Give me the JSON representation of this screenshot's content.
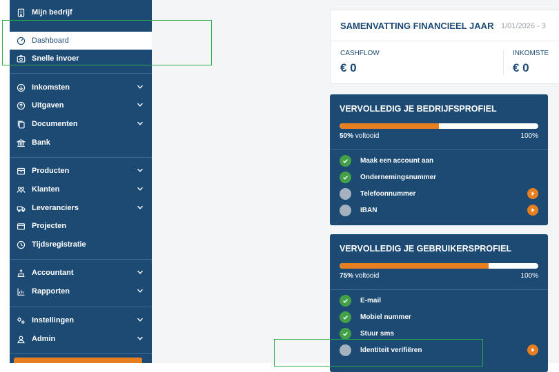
{
  "sidebar": {
    "items": [
      {
        "label": "Mijn bedrijf",
        "icon": "building-icon"
      },
      {
        "label": "Dashboard",
        "icon": "dashboard-gauge-icon"
      },
      {
        "label": "Snelle invoer",
        "icon": "camera-icon"
      },
      {
        "label": "Inkomsten",
        "icon": "arrow-down-circle-icon"
      },
      {
        "label": "Uitgaven",
        "icon": "arrow-up-circle-icon"
      },
      {
        "label": "Documenten",
        "icon": "documents-icon"
      },
      {
        "label": "Bank",
        "icon": "bank-icon"
      },
      {
        "label": "Producten",
        "icon": "box-icon"
      },
      {
        "label": "Klanten",
        "icon": "customers-icon"
      },
      {
        "label": "Leveranciers",
        "icon": "truck-icon"
      },
      {
        "label": "Projecten",
        "icon": "folder-icon"
      },
      {
        "label": "Tijdsregistratie",
        "icon": "clock-icon"
      },
      {
        "label": "Accountant",
        "icon": "accountant-icon"
      },
      {
        "label": "Rapporten",
        "icon": "reports-icon"
      },
      {
        "label": "Instellingen",
        "icon": "settings-icon"
      },
      {
        "label": "Admin",
        "icon": "admin-user-icon"
      }
    ]
  },
  "summary": {
    "title": "SAMENVATTING FINANCIEEL JAAR",
    "date": "1/01/2026 - 3",
    "kpis": [
      {
        "label": "CASHFLOW",
        "value": "€ 0"
      },
      {
        "label": "INKOMSTE",
        "value": "€ 0"
      }
    ]
  },
  "company_profile": {
    "title": "VERVOLLEDIG JE BEDRIJFSPROFIEL",
    "progress_percent": 50,
    "progress_label_value": "50%",
    "progress_label_text": "voltooid",
    "progress_max": "100%",
    "tasks": [
      {
        "label": "Maak een account aan",
        "done": true
      },
      {
        "label": "Ondernemingsnummer",
        "done": true
      },
      {
        "label": "Telefoonnummer",
        "done": false
      },
      {
        "label": "IBAN",
        "done": false
      }
    ]
  },
  "user_profile": {
    "title": "VERVOLLEDIG JE GEBRUIKERSPROFIEL",
    "progress_percent": 75,
    "progress_label_value": "75%",
    "progress_label_text": "voltooid",
    "progress_max": "100%",
    "tasks": [
      {
        "label": "E-mail",
        "done": true
      },
      {
        "label": "Mobiel nummer",
        "done": true
      },
      {
        "label": "Stuur sms",
        "done": true
      },
      {
        "label": "Identiteit verifiëren",
        "done": false
      }
    ]
  },
  "colors": {
    "sidebar": "#1c4a73",
    "accent": "#e67e22",
    "done": "#43a047",
    "todo": "#a4b1be",
    "highlight": "#2eaa4a"
  }
}
